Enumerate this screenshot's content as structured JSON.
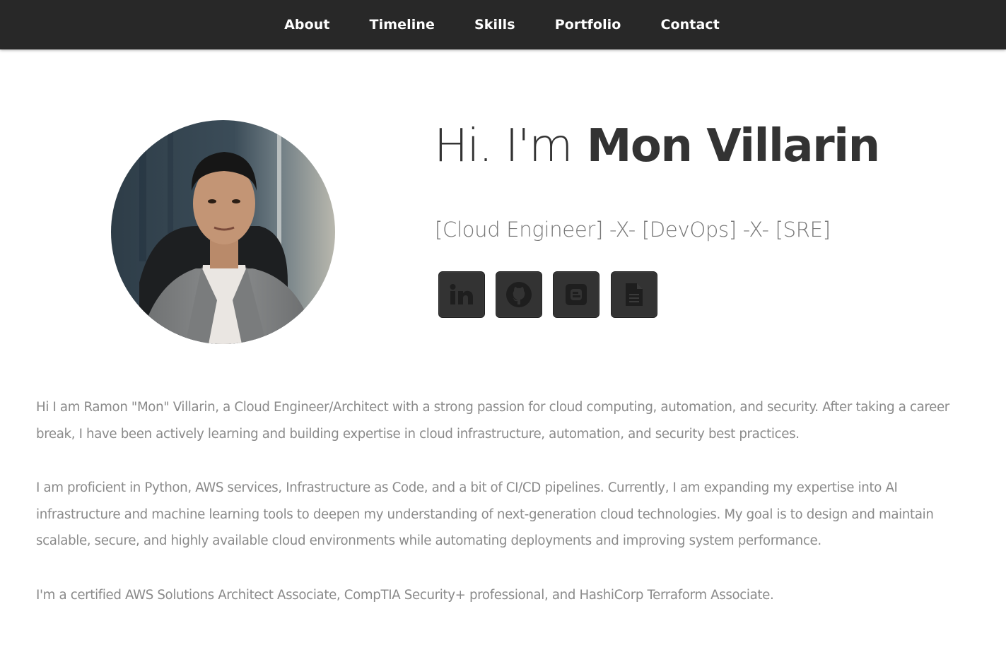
{
  "nav": {
    "items": [
      {
        "label": "About"
      },
      {
        "label": "Timeline"
      },
      {
        "label": "Skills"
      },
      {
        "label": "Portfolio"
      },
      {
        "label": "Contact"
      }
    ]
  },
  "hero": {
    "greeting": "Hi. I'm",
    "name": "Mon Villarin",
    "subtitle": "[Cloud Engineer] -X- [DevOps] -X- [SRE]",
    "social": [
      {
        "icon": "linkedin-icon"
      },
      {
        "icon": "github-icon"
      },
      {
        "icon": "blog-icon"
      },
      {
        "icon": "resume-document-icon"
      }
    ]
  },
  "bio": {
    "paragraphs": [
      "Hi I am Ramon \"Mon\" Villarin, a Cloud Engineer/Architect with a strong passion for cloud computing, automation, and security. After taking a career break, I have been actively learning and building expertise in cloud infrastructure, automation, and security best practices.",
      "I am proficient in Python, AWS services, Infrastructure as Code, and a bit of CI/CD pipelines. Currently, I am expanding my expertise into AI infrastructure and machine learning tools to deepen my understanding of next-generation cloud technologies. My goal is to design and maintain scalable, secure, and highly available cloud environments while automating deployments and improving system performance.",
      "I'm a certified AWS Solutions Architect Associate, CompTIA Security+ professional, and HashiCorp Terraform Associate."
    ]
  },
  "colors": {
    "navbar": "#282828",
    "heading": "#333333",
    "subtitle": "#777777",
    "body_text": "#8a8a8a",
    "social_button": "#333333"
  }
}
